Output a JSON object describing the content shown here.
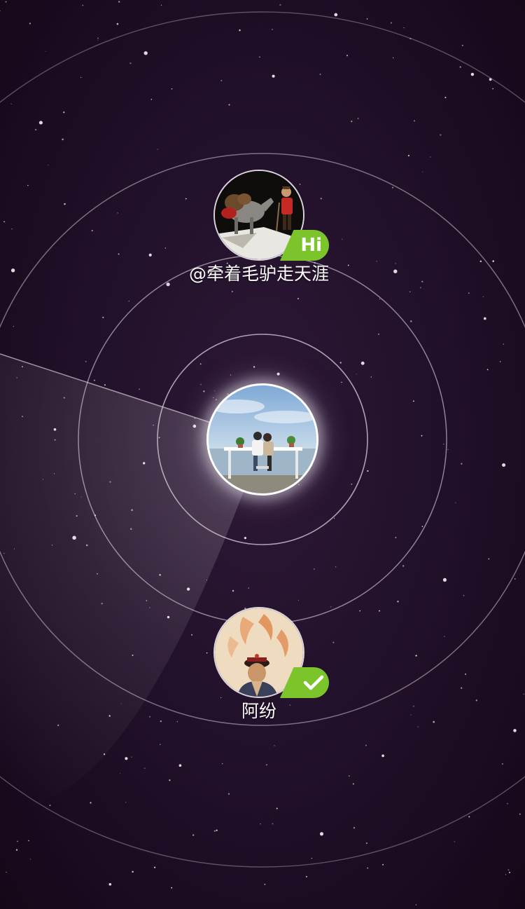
{
  "app": {
    "background_color": "#22112a",
    "ring_color": "#d8d0de",
    "badge_color": "#7cc42c"
  },
  "center": {
    "avatar_icon": "couple-on-bench-photo"
  },
  "users": [
    {
      "name": "@牵着毛驴走天涯",
      "avatar_icon": "man-with-donkey-photo",
      "badge": "Hi",
      "badge_icon": "hi-bubble"
    },
    {
      "name": "阿纷",
      "avatar_icon": "qing-official-painting",
      "badge": "",
      "badge_icon": "check-icon"
    }
  ]
}
